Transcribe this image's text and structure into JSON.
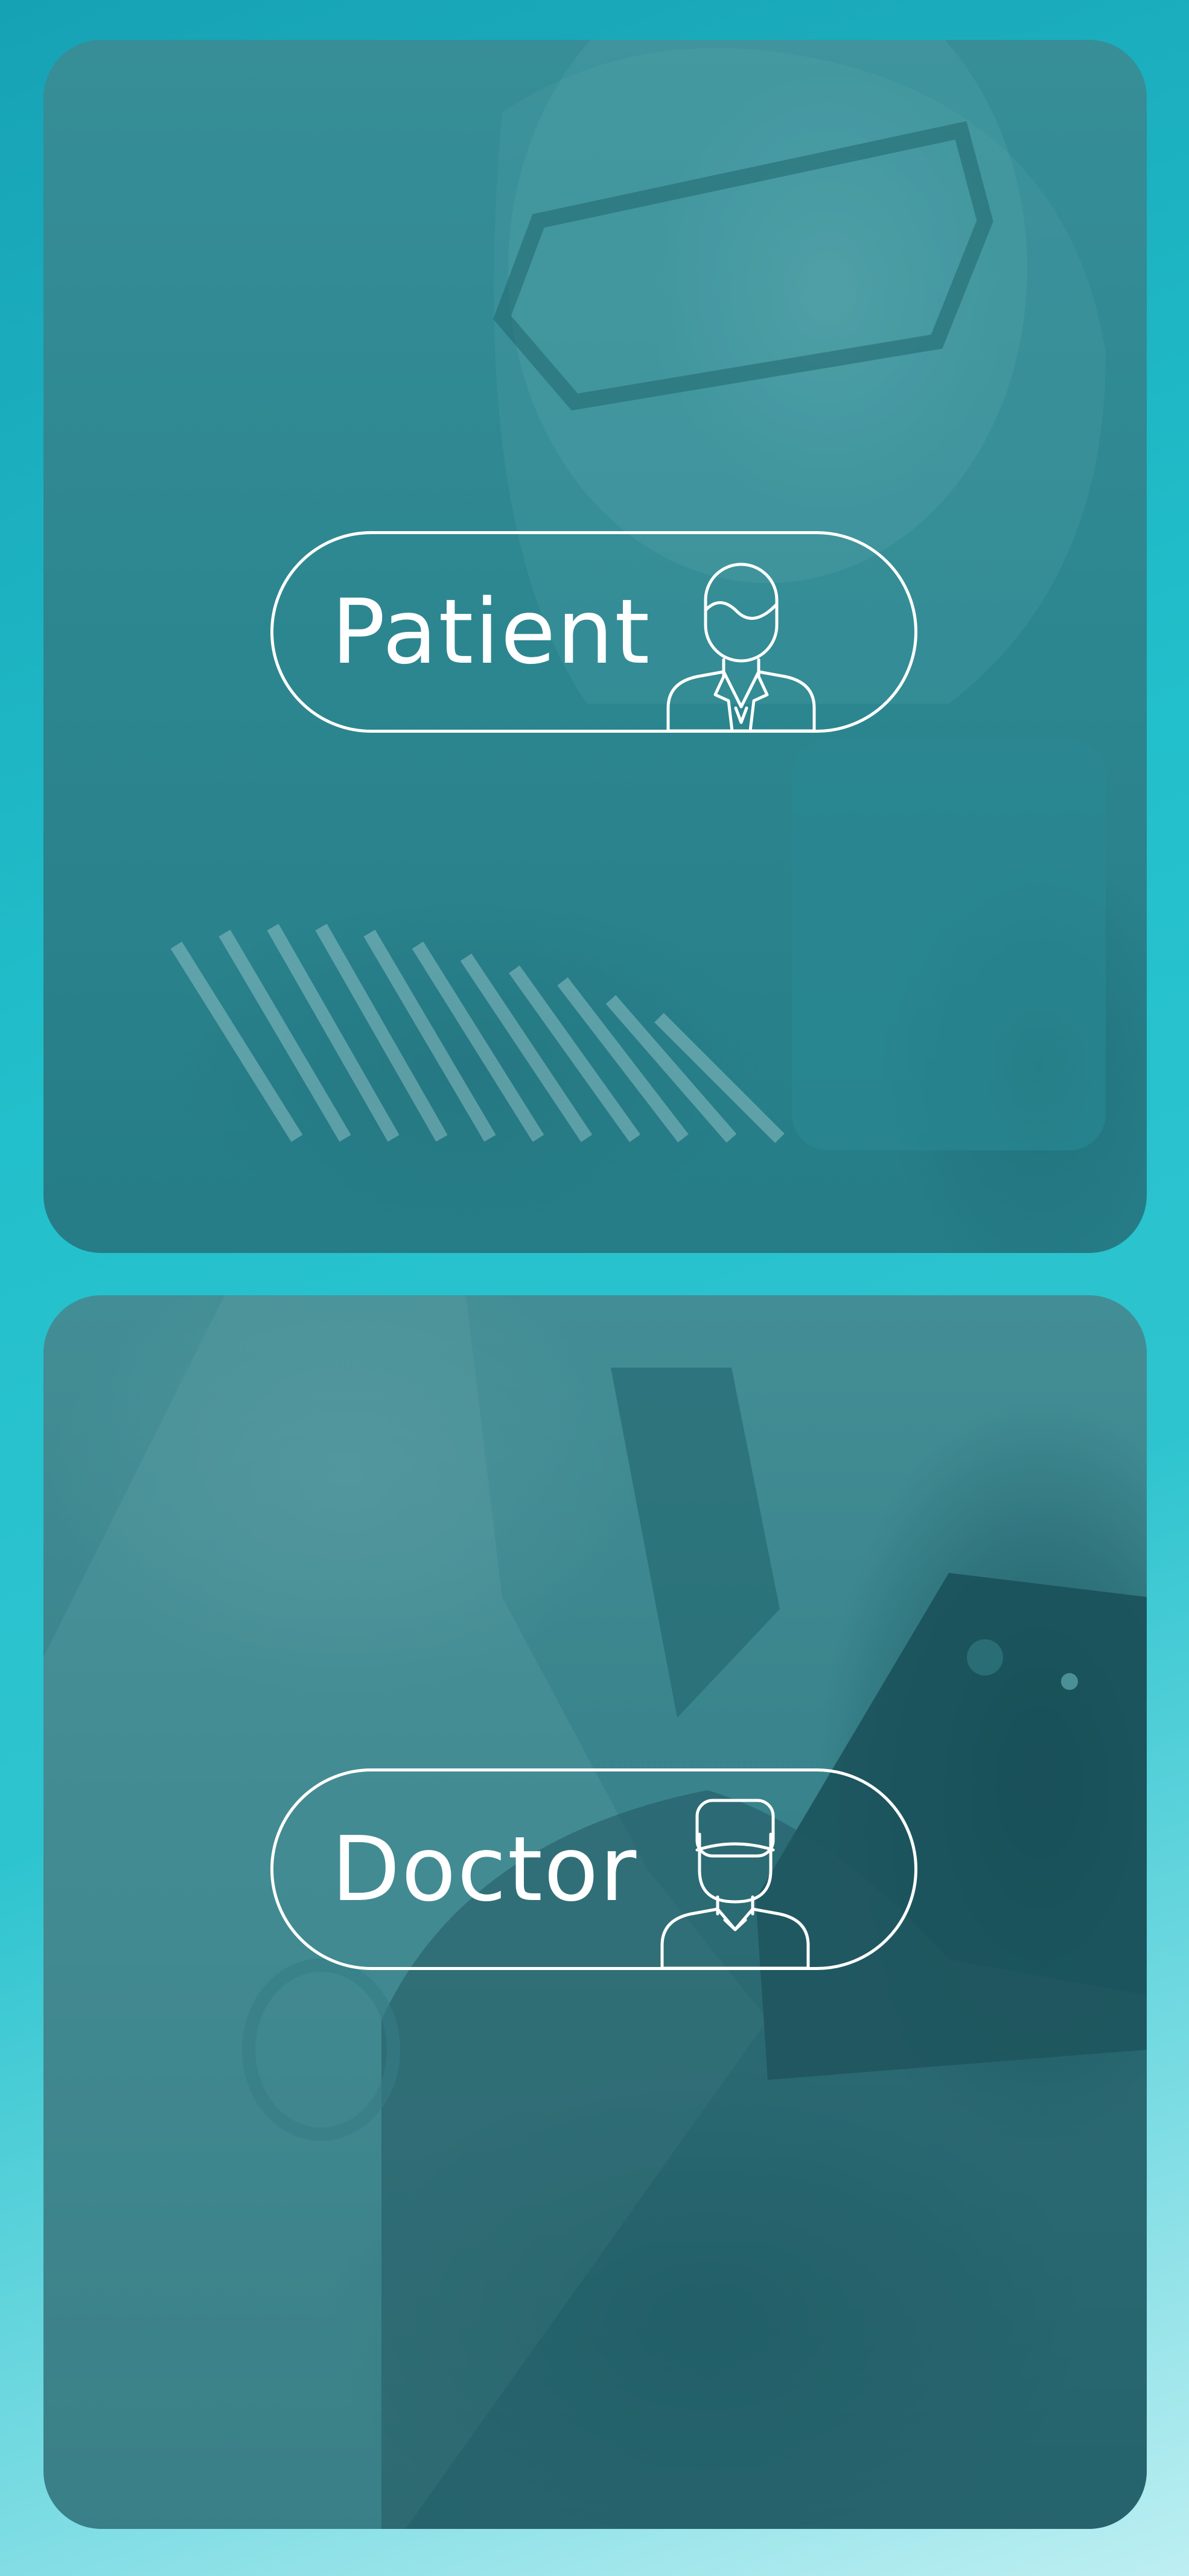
{
  "roles": {
    "patient": {
      "label": "Patient",
      "icon": "patient-icon"
    },
    "doctor": {
      "label": "Doctor",
      "icon": "doctor-icon"
    }
  },
  "colors": {
    "background_gradient": [
      "#16a2b5",
      "#2ec4cf",
      "#bdeff2"
    ],
    "card_tint": "#2f8790",
    "pill_outline": "#ffffff",
    "label_color": "#ffffff"
  }
}
